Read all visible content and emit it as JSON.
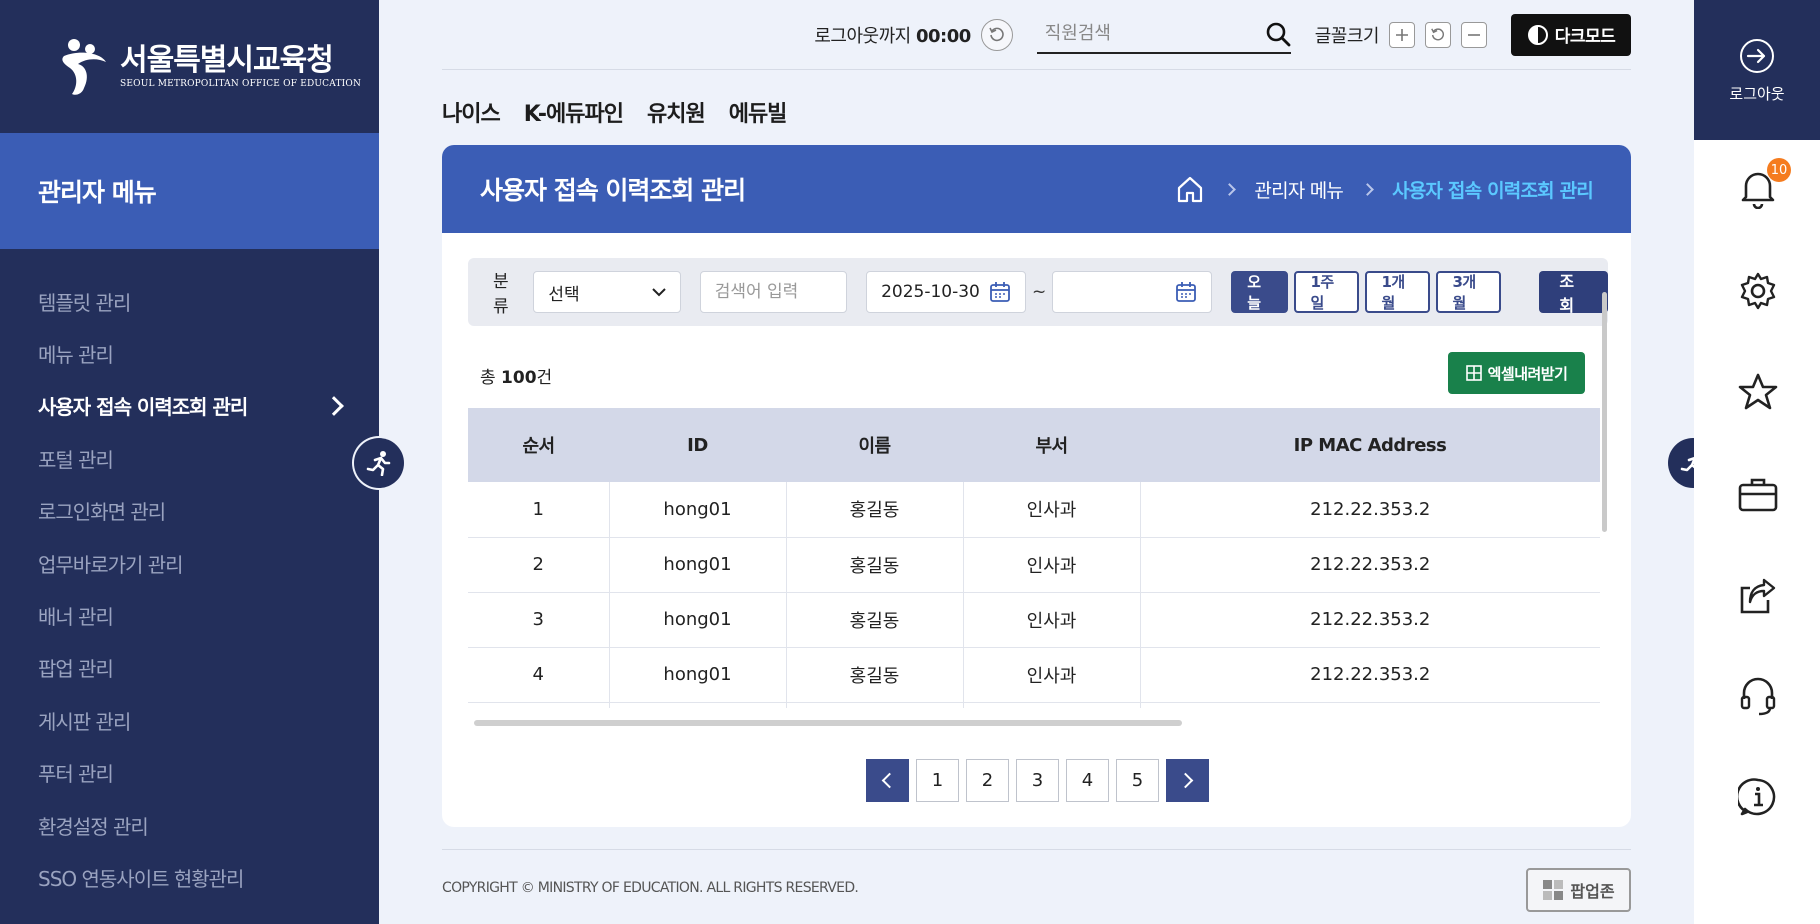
{
  "sidebar": {
    "logo_kr": "서울특별시교육청",
    "logo_en": "SEOUL METROPOLITAN OFFICE OF EDUCATION",
    "menu_title": "관리자 메뉴",
    "items": [
      {
        "label": "템플릿 관리"
      },
      {
        "label": "메뉴 관리"
      },
      {
        "label": "사용자 접속 이력조회 관리",
        "active": true
      },
      {
        "label": "포털 관리"
      },
      {
        "label": "로그인화면 관리"
      },
      {
        "label": "업무바로가기 관리"
      },
      {
        "label": "배너 관리"
      },
      {
        "label": "팝업 관리"
      },
      {
        "label": "게시판 관리"
      },
      {
        "label": "푸터 관리"
      },
      {
        "label": "환경설정 관리"
      },
      {
        "label": "SSO 연동사이트 현황관리"
      }
    ]
  },
  "topbar": {
    "timer_label": "로그아웃까지",
    "timer_value": "00:00",
    "search_placeholder": "직원검색",
    "font_size_label": "글꼴크기",
    "dark_mode_label": "다크모드"
  },
  "tabs": [
    "나이스",
    "K-에듀파인",
    "유치원",
    "에듀빌"
  ],
  "page": {
    "title": "사용자 접속 이력조회 관리",
    "breadcrumb": [
      "관리자 메뉴",
      "사용자 접속 이력조회 관리"
    ]
  },
  "filter": {
    "category_label": "분류",
    "category_value": "선택",
    "keyword_placeholder": "검색어 입력",
    "start_date": "2025-10-30",
    "end_date": "",
    "tilde": "~",
    "periods": [
      "오늘",
      "1주일",
      "1개월",
      "3개월"
    ],
    "query_label": "조회"
  },
  "summary": {
    "prefix": "총",
    "count": "100",
    "suffix": "건",
    "excel_label": "엑셀내려받기"
  },
  "table": {
    "columns": [
      "순서",
      "ID",
      "이름",
      "부서",
      "IP MAC Address"
    ],
    "rows": [
      [
        "1",
        "hong01",
        "홍길동",
        "인사과",
        "212.22.353.2"
      ],
      [
        "2",
        "hong01",
        "홍길동",
        "인사과",
        "212.22.353.2"
      ],
      [
        "3",
        "hong01",
        "홍길동",
        "인사과",
        "212.22.353.2"
      ],
      [
        "4",
        "hong01",
        "홍길동",
        "인사과",
        "212.22.353.2"
      ]
    ]
  },
  "pagination": {
    "pages": [
      "1",
      "2",
      "3",
      "4",
      "5"
    ]
  },
  "footer": {
    "copyright": "COPYRIGHT © MINISTRY OF EDUCATION. ALL RIGHTS RESERVED.",
    "popup_zone_label": "팝업존"
  },
  "rail": {
    "logout_label": "로그아웃",
    "notification_count": "10",
    "icons": [
      "bell-icon",
      "gear-icon",
      "star-icon",
      "briefcase-icon",
      "share-icon",
      "headset-icon",
      "info-icon"
    ]
  },
  "colors": {
    "navy": "#232f5b",
    "brand_blue": "#3b5db5",
    "crumb_active": "#5bc8ff",
    "excel_green": "#19814b",
    "badge_orange": "#f57c1f"
  }
}
